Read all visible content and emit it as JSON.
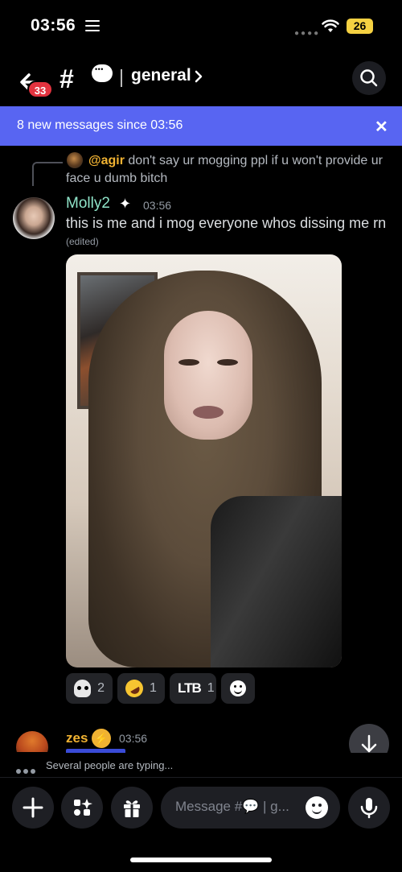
{
  "status_bar": {
    "time": "03:56",
    "battery": "26"
  },
  "header": {
    "unread_badge": "33",
    "channel_name": "general",
    "hash_symbol": "#"
  },
  "new_messages_banner": {
    "text": "8 new messages since 03:56"
  },
  "reply": {
    "mention": "@agir",
    "text": "don't say ur mogging ppl if u won't provide ur face u dumb bitch"
  },
  "message": {
    "author": "Molly2",
    "timestamp": "03:56",
    "text": "this is me and i mog everyone whos dissing me rn",
    "edited_label": "(edited)"
  },
  "reactions": [
    {
      "icon": "skull-emoji",
      "count": "2"
    },
    {
      "icon": "rofl-emoji",
      "count": "1"
    },
    {
      "icon": "ltb-emoji",
      "label": "LTB",
      "count": "1"
    },
    {
      "icon": "add-reaction-icon"
    }
  ],
  "next_message": {
    "author": "zes",
    "timestamp": "03:56"
  },
  "typing_indicator": {
    "text": "Several people are typing..."
  },
  "composer": {
    "placeholder": "Message #💬 | g..."
  },
  "colors": {
    "banner": "#5865f2",
    "author_molly": "#8fe3c8",
    "author_zes": "#f0b232",
    "badge": "#e3333f"
  }
}
